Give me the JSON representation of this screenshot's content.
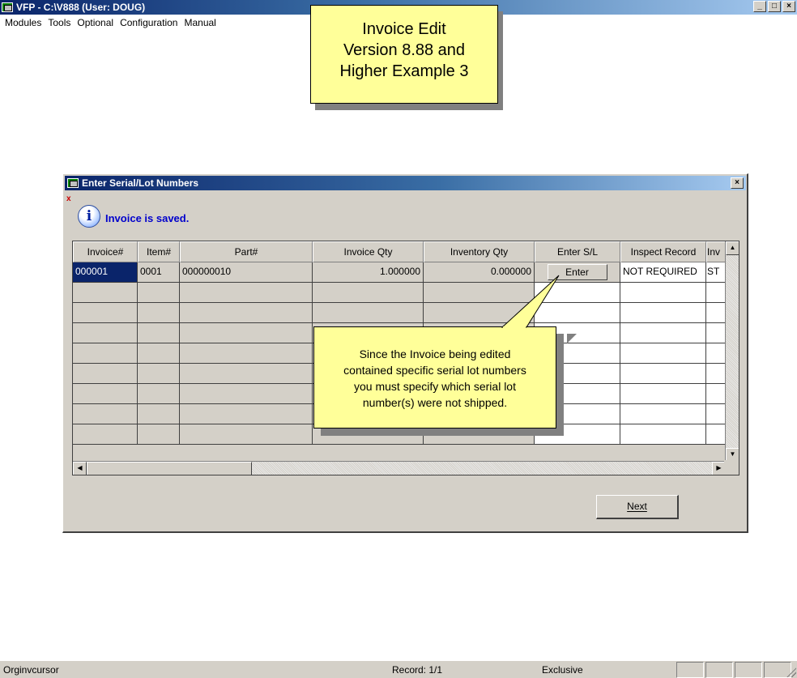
{
  "app": {
    "title": "VFP - C:\\V888  (User: DOUG)",
    "controls": {
      "minimize": "_",
      "maximize": "□",
      "close": "×"
    }
  },
  "menu": {
    "items": [
      "Modules",
      "Tools",
      "Optional",
      "Configuration",
      "Manual"
    ]
  },
  "callout_title": {
    "lines": [
      "Invoice Edit",
      "Version 8.88 and",
      "Higher Example 3"
    ]
  },
  "dialog": {
    "title": "Enter Serial/Lot Numbers",
    "close_glyph": "×",
    "mini_close": "x",
    "info_icon_glyph": "i",
    "message": "Invoice is saved.",
    "next_label": "Next"
  },
  "grid": {
    "columns": [
      "Invoice#",
      "Item#",
      "Part#",
      "Invoice Qty",
      "Inventory Qty",
      "Enter S/L",
      "Inspect Record",
      "Inv"
    ],
    "rows": [
      [
        "000001",
        "0001",
        "000000010",
        "1.000000",
        "0.000000",
        "Enter",
        "NOT REQUIRED",
        "ST"
      ]
    ],
    "empty_rows": 8,
    "scroll_arrows": {
      "up": "▲",
      "down": "▼",
      "left": "◀",
      "right": "▶"
    }
  },
  "callout_note": {
    "lines": [
      "Since the Invoice being edited",
      "contained specific serial lot numbers",
      "you must specify which serial lot",
      "number(s) were not shipped."
    ]
  },
  "status": {
    "cursor": "Orginvcursor",
    "record": "Record: 1/1",
    "mode": "Exclusive"
  },
  "colors": {
    "titlebar": "#0a246a",
    "callout": "#ffff99",
    "selection": "#0a246a",
    "message": "#0000cc",
    "dialog_bg": "#d4d0c8"
  },
  "icons": [
    "app-window-icon",
    "info-icon",
    "close-icon",
    "scroll-arrow-icons"
  ]
}
